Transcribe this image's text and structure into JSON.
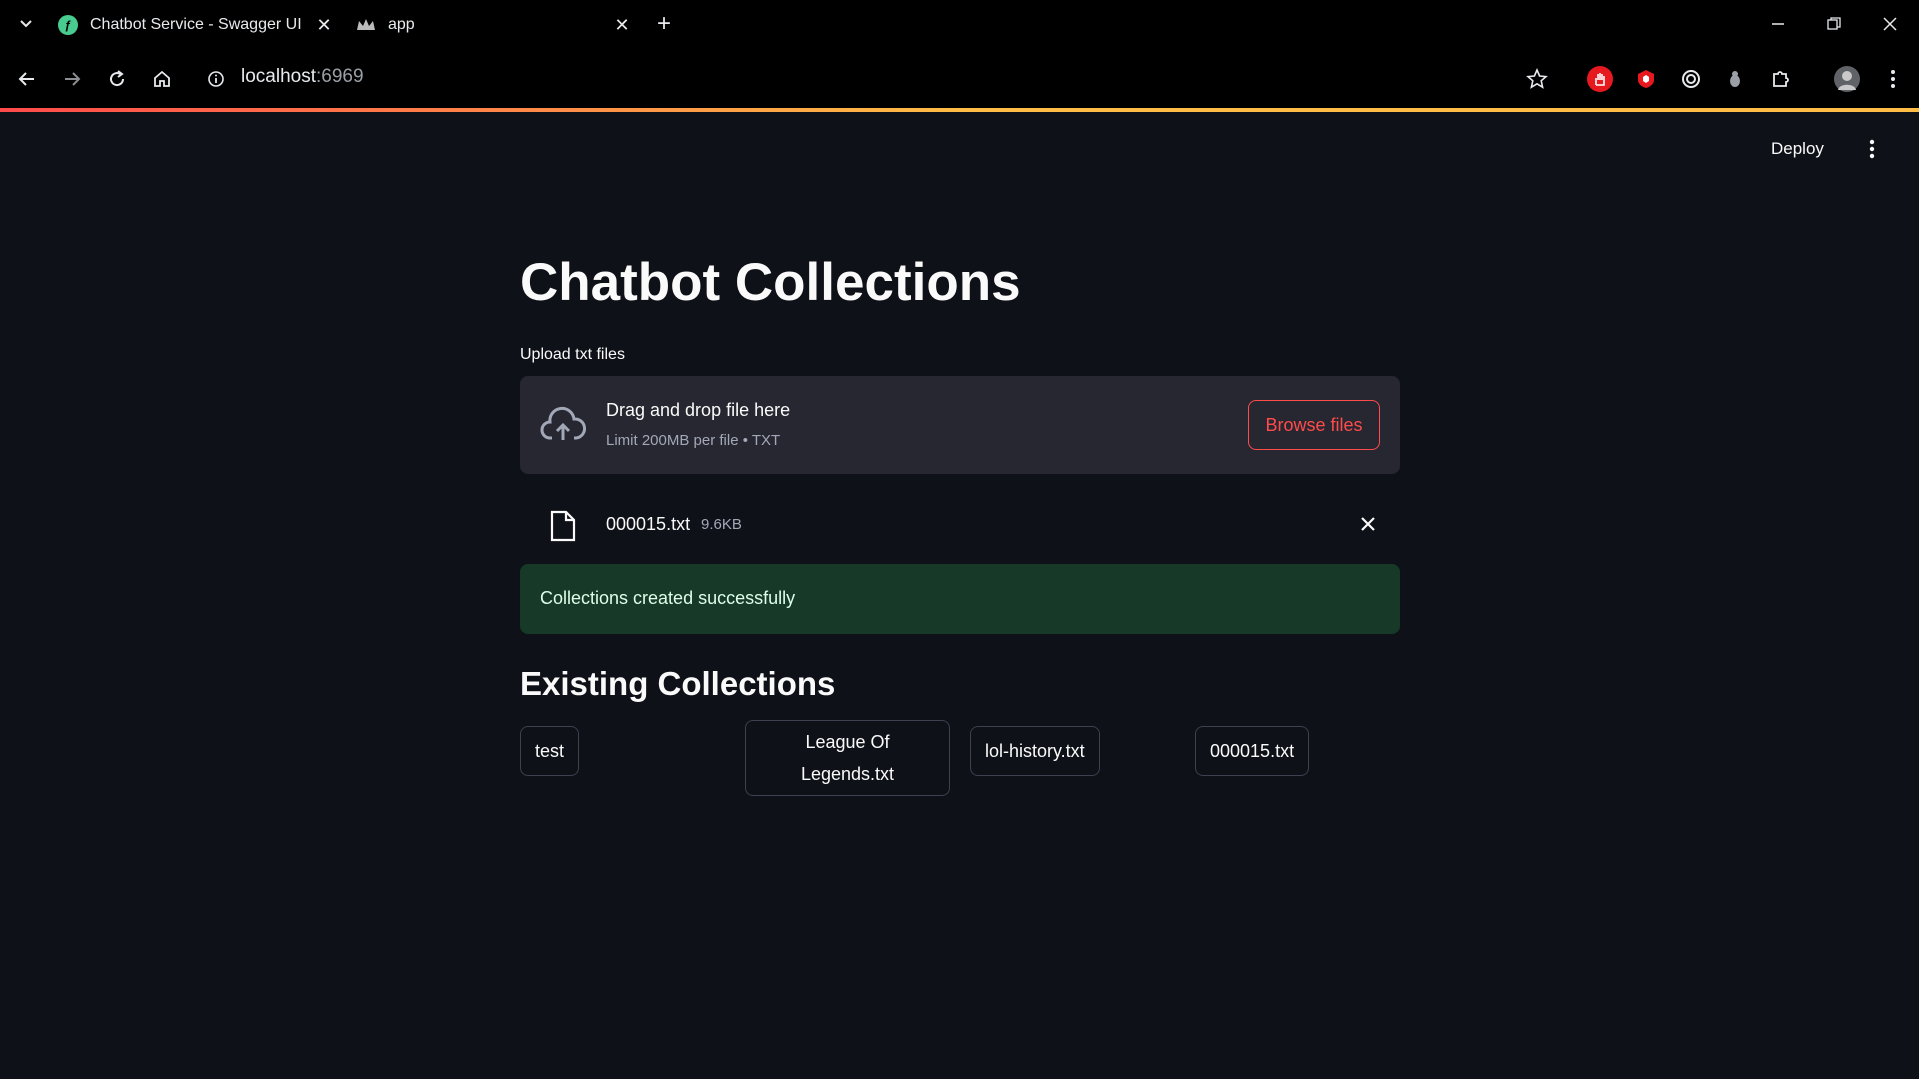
{
  "browser": {
    "tabs": [
      {
        "title": "Chatbot Service - Swagger UI",
        "favicon": "swagger-icon",
        "active": false
      },
      {
        "title": "app",
        "favicon": "streamlit-crown-icon",
        "active": true
      }
    ],
    "url_host": "localhost",
    "url_port": ":6969"
  },
  "app_header": {
    "deploy_label": "Deploy",
    "menu_icon": "kebab-menu-icon"
  },
  "page": {
    "title": "Chatbot Collections",
    "uploader": {
      "label": "Upload txt files",
      "drop_text": "Drag and drop file here",
      "limit_text": "Limit 200MB per file • TXT",
      "browse_label": "Browse files"
    },
    "uploaded_file": {
      "name": "000015.txt",
      "size": "9.6KB"
    },
    "alert": {
      "text": "Collections created successfully"
    },
    "existing_heading": "Existing Collections",
    "collections": [
      {
        "label": "test"
      },
      {
        "label": "League Of Legends.txt"
      },
      {
        "label": "lol-history.txt"
      },
      {
        "label": "000015.txt"
      }
    ]
  },
  "colors": {
    "background": "#0e1117",
    "accent": "#ff4b4b",
    "success_bg": "#173928",
    "dropzone_bg": "#262730"
  }
}
